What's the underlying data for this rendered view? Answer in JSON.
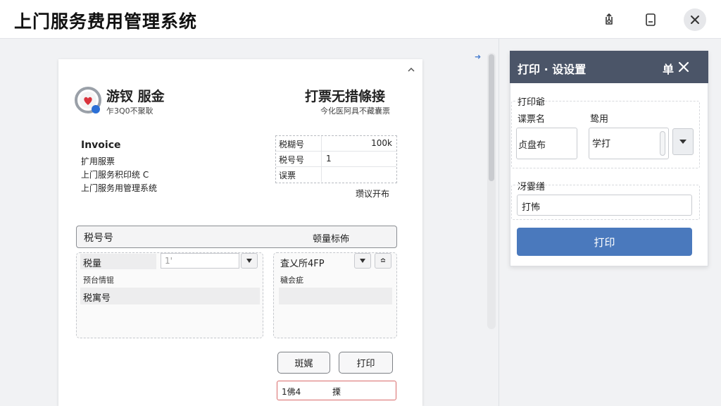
{
  "app": {
    "title": "上门服务费用管理系统"
  },
  "titlebar_icons": [
    "share-icon",
    "bookmark-icon",
    "close-icon"
  ],
  "invoice": {
    "brand_name": "游钗 服金",
    "brand_sub": "乍3Q0不聚耿",
    "doc_title": "打票无措條接",
    "doc_sub": "今化医阿具不藏囊票",
    "label": "Invoice",
    "lines": [
      "扩用服票",
      "上门服务积印统 C",
      "上门服务用管理系统"
    ],
    "info_rows": [
      {
        "key": "税糊号",
        "value": "100k"
      },
      {
        "key": "税号号",
        "value": "1"
      },
      {
        "key": "误票",
        "value": ""
      }
    ],
    "agree_text": "瓒议开布",
    "header_bar": {
      "left": "税号号",
      "right": "顿量标佈"
    },
    "left_panel": {
      "row1_label": "税量",
      "row1_input_value": "1'",
      "row2_label": "预台情锟",
      "row3_label": "税寓号"
    },
    "right_panel": {
      "row1_label": "査乂所4FP",
      "row2_label": "穢会疵"
    },
    "buttons": {
      "secondary": "斑娓",
      "print": "打印"
    },
    "bottom_input": {
      "left": "1佛4",
      "right": "搮"
    }
  },
  "dialog": {
    "title": "打印 · 设设置",
    "header_right": "单",
    "section_label": "打印爺",
    "field1_label": "谍票名",
    "field1_value": "贞盘布",
    "field2_label": "鸷用",
    "field2_value": "学打",
    "section2_label": "冴霎缮",
    "field3_value": "打怖",
    "print_button": "打印"
  },
  "colors": {
    "dialog_header": "#4b5568",
    "print_button": "#4a79bd",
    "logo_red": "#d9343d",
    "logo_blue": "#2b6fd6",
    "error_border": "#d96b6b"
  }
}
